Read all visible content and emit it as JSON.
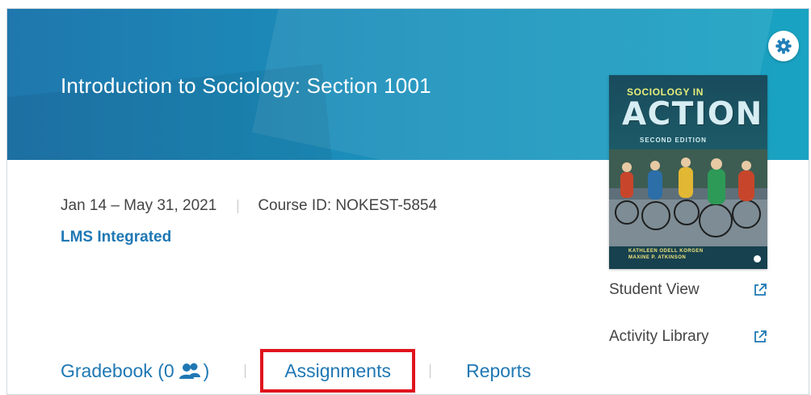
{
  "course": {
    "title": "Introduction to Sociology: Section 1001",
    "dates": "Jan 14 – May 31, 2021",
    "course_id": "Course ID: NOKEST-5854",
    "lms_status": "LMS Integrated"
  },
  "book": {
    "title_line1": "SOCIOLOGY IN",
    "title_line2": "ACTION",
    "edition": "SECOND EDITION",
    "author1": "KATHLEEN ODELL KORGEN",
    "author2": "MAXINE P. ATKINSON"
  },
  "side_links": {
    "student_view": "Student View",
    "activity_library": "Activity Library"
  },
  "tabs": {
    "gradebook": "Gradebook (0",
    "gradebook_suffix": ")",
    "assignments": "Assignments",
    "reports": "Reports"
  },
  "colors": {
    "banner": "#1b8fbb",
    "link": "#1f78b4",
    "highlight": "#e0141e"
  },
  "icons": {
    "settings": "gear-icon",
    "external_link": "external-link-icon",
    "students": "users-icon"
  }
}
